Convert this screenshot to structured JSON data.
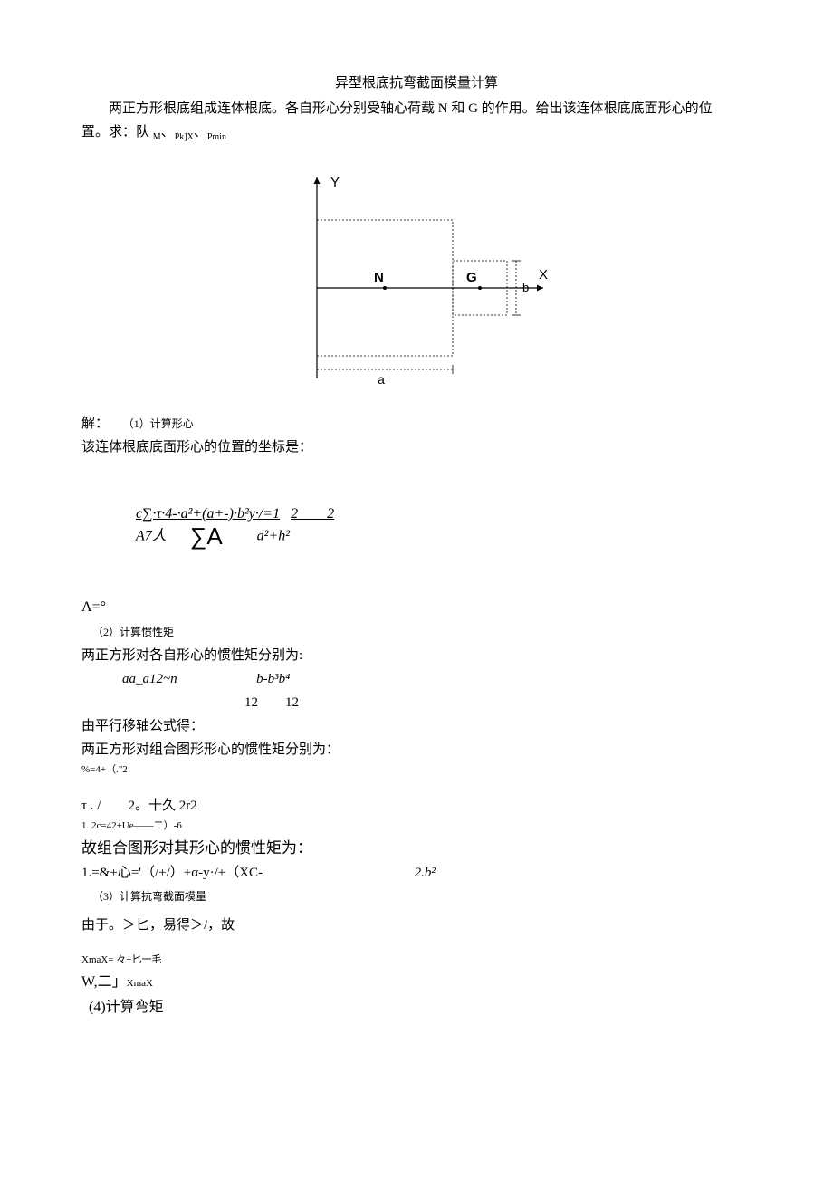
{
  "title": "异型根底抗弯截面模量计算",
  "intro_line1": "两正方形根底组成连体根底。各自形心分别受轴心荷载 N 和 G 的作用。给出该连体根底底面形心的位",
  "intro_line2_prefix": "置。求：队 ",
  "intro_symbols": {
    "m": "M",
    "sep1": "、",
    "pkx": "Pk]X",
    "sep2": "、",
    "pmin": "Pmin"
  },
  "figure": {
    "axis_y": "Y",
    "axis_x": "X",
    "point_n": "N",
    "point_g": "G",
    "dim_a": "a",
    "dim_b": "b"
  },
  "sol_label": "解：",
  "step1_label": "（1）计算形心",
  "step1_text": "该连体根底底面形心的位置的坐标是：",
  "formula1_top": "c∑·τ·4-·a²+(a+-)·b²y·/=1",
  "formula1_bot_left": "A7人",
  "formula1_bot_sigma": "∑A",
  "formula1_bot_right": "a²+h²",
  "formula1_right": "2  2",
  "lambda_line": "Λ=°",
  "step2_label": "（2）计算惯性矩",
  "step2_text1": "两正方形对各自形心的惯性矩分别为:",
  "inertia_line_left": "aa_a12~n",
  "inertia_line_right": "b-b³b⁴",
  "inertia_under": "12  12",
  "parallel_axis": "由平行移轴公式得：",
  "step2_text2": "两正方形对组合图形形心的惯性矩分别为：",
  "garble1": "%=4+（.\"2",
  "garble2": "τ . /  2。十久 2r2",
  "garble3": "1. 2c=42+Ue——二）-6",
  "combined_heading": "故组合图形对其形心的惯性矩为：",
  "combined_formula_left": "1.=&+心='（/+/）+α-y·/+（XC-",
  "combined_formula_right": "2.b²",
  "step3_label": "（3）计算抗弯截面模量",
  "step3_text": "由于。＞匕，易得＞/，故",
  "xmax_line": "XmaX= 々+匕一毛",
  "w_line": "W,二」XmaX",
  "step4_label": "(4)计算弯矩"
}
